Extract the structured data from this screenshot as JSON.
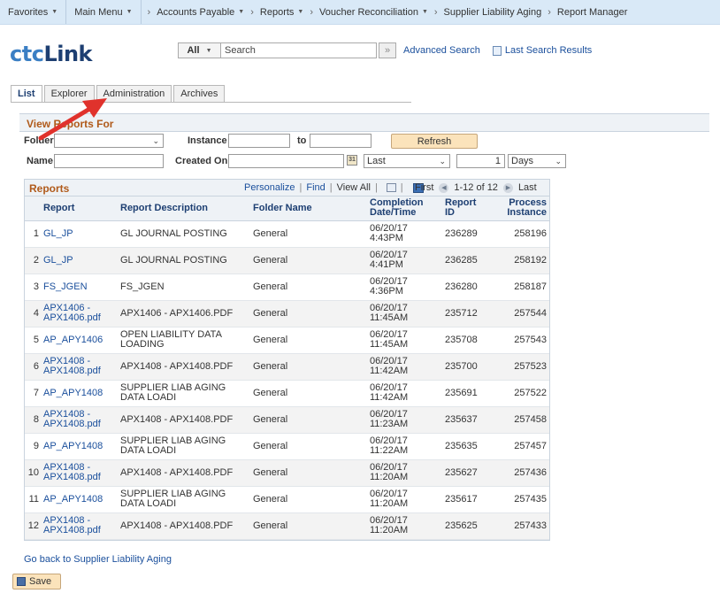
{
  "nav": {
    "favorites": "Favorites",
    "main_menu": "Main Menu",
    "breadcrumbs": [
      "Accounts Payable",
      "Reports",
      "Voucher Reconciliation",
      "Supplier Liability Aging",
      "Report Manager"
    ]
  },
  "header": {
    "logo_part1": "ctc",
    "logo_part2": "Link",
    "search_scope": "All",
    "search_placeholder": "Search",
    "advanced_search": "Advanced Search",
    "last_search_results": "Last Search Results"
  },
  "tabs": [
    "List",
    "Explorer",
    "Administration",
    "Archives"
  ],
  "filters": {
    "title": "View Reports For",
    "folder_label": "Folder",
    "folder_value": "",
    "instance_label": "Instance",
    "instance_from": "",
    "to_label": "to",
    "instance_to": "",
    "refresh": "Refresh",
    "name_label": "Name",
    "name_value": "",
    "created_on_label": "Created On",
    "created_on_value": "",
    "last_value": "Last",
    "count_value": "1",
    "unit_value": "Days"
  },
  "grid": {
    "title": "Reports",
    "personalize": "Personalize",
    "find": "Find",
    "view_all": "View All",
    "first": "First",
    "range": "1-12 of 12",
    "last": "Last",
    "columns": [
      "Report",
      "Report Description",
      "Folder Name",
      "Completion Date/Time",
      "Report ID",
      "Process Instance"
    ],
    "rows": [
      {
        "n": "1",
        "report": "GL_JP",
        "desc": "GL JOURNAL POSTING",
        "folder": "General",
        "date": "06/20/17",
        "time": "4:43PM",
        "id": "236289",
        "instance": "258196"
      },
      {
        "n": "2",
        "report": "GL_JP",
        "desc": "GL JOURNAL POSTING",
        "folder": "General",
        "date": "06/20/17",
        "time": "4:41PM",
        "id": "236285",
        "instance": "258192"
      },
      {
        "n": "3",
        "report": "FS_JGEN",
        "desc": "FS_JGEN",
        "folder": "General",
        "date": "06/20/17",
        "time": "4:36PM",
        "id": "236280",
        "instance": "258187"
      },
      {
        "n": "4",
        "report": "APX1406 - APX1406.pdf",
        "desc": "APX1406 - APX1406.PDF",
        "folder": "General",
        "date": "06/20/17",
        "time": "11:45AM",
        "id": "235712",
        "instance": "257544"
      },
      {
        "n": "5",
        "report": "AP_APY1406",
        "desc": "OPEN LIABILITY DATA LOADING",
        "folder": "General",
        "date": "06/20/17",
        "time": "11:45AM",
        "id": "235708",
        "instance": "257543"
      },
      {
        "n": "6",
        "report": "APX1408 - APX1408.pdf",
        "desc": "APX1408 - APX1408.PDF",
        "folder": "General",
        "date": "06/20/17",
        "time": "11:42AM",
        "id": "235700",
        "instance": "257523"
      },
      {
        "n": "7",
        "report": "AP_APY1408",
        "desc": "SUPPLIER LIAB AGING DATA LOADI",
        "folder": "General",
        "date": "06/20/17",
        "time": "11:42AM",
        "id": "235691",
        "instance": "257522"
      },
      {
        "n": "8",
        "report": "APX1408 - APX1408.pdf",
        "desc": "APX1408 - APX1408.PDF",
        "folder": "General",
        "date": "06/20/17",
        "time": "11:23AM",
        "id": "235637",
        "instance": "257458"
      },
      {
        "n": "9",
        "report": "AP_APY1408",
        "desc": "SUPPLIER LIAB AGING DATA LOADI",
        "folder": "General",
        "date": "06/20/17",
        "time": "11:22AM",
        "id": "235635",
        "instance": "257457"
      },
      {
        "n": "10",
        "report": "APX1408 - APX1408.pdf",
        "desc": "APX1408 - APX1408.PDF",
        "folder": "General",
        "date": "06/20/17",
        "time": "11:20AM",
        "id": "235627",
        "instance": "257436"
      },
      {
        "n": "11",
        "report": "AP_APY1408",
        "desc": "SUPPLIER LIAB AGING DATA LOADI",
        "folder": "General",
        "date": "06/20/17",
        "time": "11:20AM",
        "id": "235617",
        "instance": "257435"
      },
      {
        "n": "12",
        "report": "APX1408 - APX1408.pdf",
        "desc": "APX1408 - APX1408.PDF",
        "folder": "General",
        "date": "06/20/17",
        "time": "11:20AM",
        "id": "235625",
        "instance": "257433"
      }
    ]
  },
  "footer": {
    "back_link": "Go back to Supplier Liability Aging",
    "save": "Save"
  },
  "colors": {
    "nav_bg": "#d9e9f7",
    "section_title": "#b05a1a",
    "link": "#1a4f9c",
    "button_bg": "#fbe3bb",
    "annotation_arrow": "#e0322c"
  }
}
